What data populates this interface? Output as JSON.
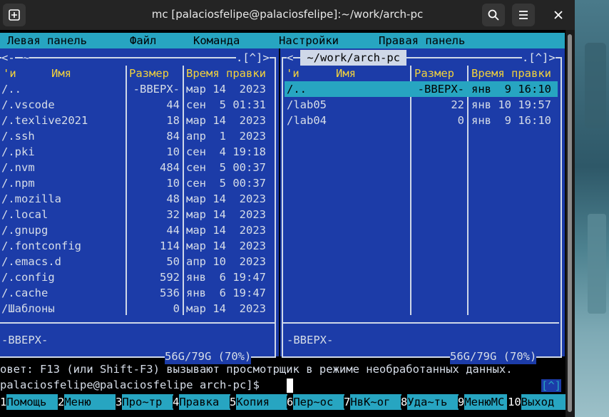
{
  "window": {
    "title": "mc [palaciosfelipe@palaciosfelipe]:~/work/arch-pc"
  },
  "menubar": {
    "items": [
      "Левая панель",
      "Файл",
      "Команда",
      "Настройки",
      "Правая панель"
    ]
  },
  "left_panel": {
    "path": "~",
    "corner_left": "<-",
    "corner_right": ".[^]>",
    "headers": {
      "n": "'и",
      "name": "Имя",
      "size": "Размер",
      "mtime": "Время правки"
    },
    "files": [
      {
        "name": "/..",
        "size": "-ВВЕРХ-",
        "mtime": "мар 14  2023"
      },
      {
        "name": "/.vscode",
        "size": "44",
        "mtime": "сен  5 01:31"
      },
      {
        "name": "/.texlive2021",
        "size": "18",
        "mtime": "мар 14  2023"
      },
      {
        "name": "/.ssh",
        "size": "84",
        "mtime": "апр  1  2023"
      },
      {
        "name": "/.pki",
        "size": "10",
        "mtime": "сен  4 19:18"
      },
      {
        "name": "/.nvm",
        "size": "484",
        "mtime": "сен  5 00:37"
      },
      {
        "name": "/.npm",
        "size": "10",
        "mtime": "сен  5 00:37"
      },
      {
        "name": "/.mozilla",
        "size": "48",
        "mtime": "мар 14  2023"
      },
      {
        "name": "/.local",
        "size": "32",
        "mtime": "мар 14  2023"
      },
      {
        "name": "/.gnupg",
        "size": "44",
        "mtime": "мар 14  2023"
      },
      {
        "name": "/.fontconfig",
        "size": "114",
        "mtime": "мар 14  2023"
      },
      {
        "name": "/.emacs.d",
        "size": "50",
        "mtime": "апр 10  2023"
      },
      {
        "name": "/.config",
        "size": "592",
        "mtime": "янв  6 19:47"
      },
      {
        "name": "/.cache",
        "size": "536",
        "mtime": "янв  6 19:47"
      },
      {
        "name": "/Шаблоны",
        "size": "0",
        "mtime": "мар 14  2023"
      }
    ],
    "status": "-ВВЕРХ-",
    "disk": "56G/79G (70%)"
  },
  "right_panel": {
    "path": " ~/work/arch-pc ",
    "corner_left": "<",
    "corner_right": ".[^]>",
    "headers": {
      "n": "'и",
      "name": "Имя",
      "size": "Размер",
      "mtime": "Время правки"
    },
    "files": [
      {
        "name": "/..",
        "size": "-ВВЕРХ-",
        "mtime": "янв  9 16:10"
      },
      {
        "name": "/lab05",
        "size": "22",
        "mtime": "янв 10 19:57"
      },
      {
        "name": "/lab04",
        "size": "0",
        "mtime": "янв  9 16:10"
      }
    ],
    "status": "-ВВЕРХ-",
    "disk": "56G/79G (70%)"
  },
  "hint": "овет: F13 (или Shift-F3) вызывают просмотрщик в режиме необработанных данных.",
  "prompt": "palaciosfelipe@palaciosfelipe arch-pc]$",
  "cmd_history": "[^]",
  "fkeys": [
    {
      "n": "1",
      "label": "Помощь"
    },
    {
      "n": "2",
      "label": "Меню"
    },
    {
      "n": "3",
      "label": "Про~тр"
    },
    {
      "n": "4",
      "label": "Правка"
    },
    {
      "n": "5",
      "label": "Копия"
    },
    {
      "n": "6",
      "label": "Пер~ос"
    },
    {
      "n": "7",
      "label": "НвК~ог"
    },
    {
      "n": "8",
      "label": "Уда~ть"
    },
    {
      "n": "9",
      "label": "МенюMC"
    },
    {
      "n": "10",
      "label": "Выход"
    }
  ],
  "icons": {
    "new_tab": "plus-icon",
    "search": "search-icon",
    "menu": "hamburger-icon",
    "close": "close-icon"
  }
}
